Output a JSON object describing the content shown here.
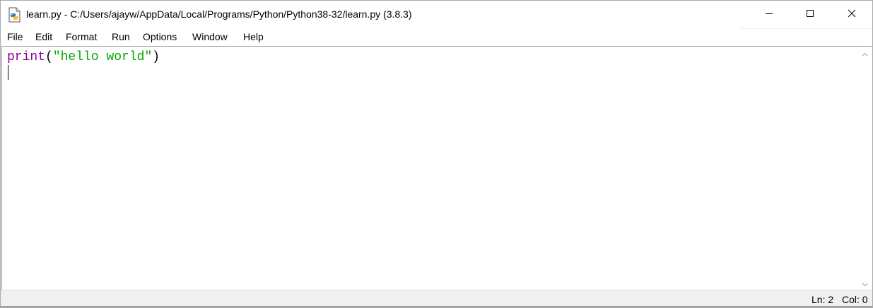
{
  "window": {
    "title": "learn.py - C:/Users/ajayw/AppData/Local/Programs/Python/Python38-32/learn.py (3.8.3)",
    "icon": "python-file-icon",
    "controls": {
      "minimize_icon": "minimize-icon",
      "maximize_icon": "maximize-icon",
      "close_icon": "close-icon"
    }
  },
  "menubar": {
    "items": [
      "File",
      "Edit",
      "Format",
      "Run",
      "Options",
      "Window",
      "Help"
    ]
  },
  "editor": {
    "lines": [
      {
        "tokens": [
          {
            "text": "print",
            "kind": "builtin"
          },
          {
            "text": "(",
            "kind": "punc"
          },
          {
            "text": "\"hello world\"",
            "kind": "string"
          },
          {
            "text": ")",
            "kind": "punc"
          }
        ]
      },
      {
        "tokens": []
      }
    ],
    "colors": {
      "builtin": "#900090",
      "string": "#00aa00",
      "text": "#000000"
    }
  },
  "statusbar": {
    "line": "Ln: 2",
    "column": "Col: 0"
  }
}
